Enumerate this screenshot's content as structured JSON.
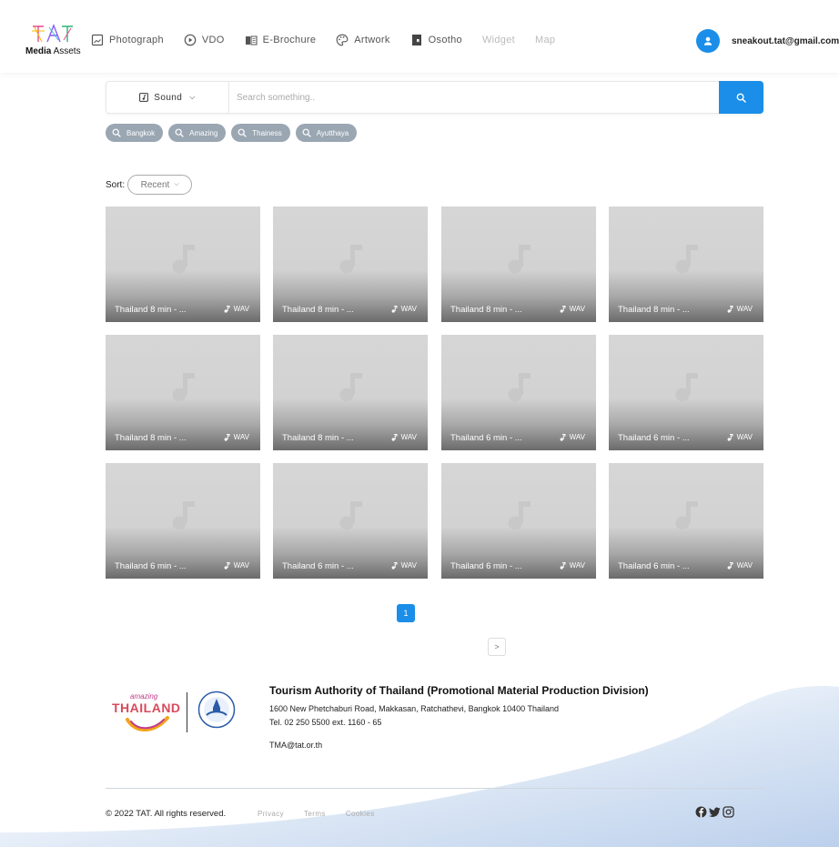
{
  "header": {
    "logo_text_bold": "Media",
    "logo_text": "Assets",
    "nav": [
      {
        "label": "Photograph",
        "icon": "photo-icon"
      },
      {
        "label": "VDO",
        "icon": "play-icon"
      },
      {
        "label": "E-Brochure",
        "icon": "book-icon"
      },
      {
        "label": "Artwork",
        "icon": "palette-icon"
      },
      {
        "label": "Osotho",
        "icon": "bookmark-icon"
      },
      {
        "label": "Widget",
        "icon": ""
      },
      {
        "label": "Map",
        "icon": ""
      }
    ],
    "user_email": "sneakout.tat@gmail.com"
  },
  "search": {
    "type_label": "Sound",
    "placeholder": "Search something..",
    "value": ""
  },
  "tags": [
    "Bangkok",
    "Amazing",
    "Thainess",
    "Ayutthaya"
  ],
  "sort": {
    "label": "Sort:",
    "value": "Recent"
  },
  "cards": [
    {
      "title": "Thailand 8 min - ...",
      "format": "WAV"
    },
    {
      "title": "Thailand 8 min - ...",
      "format": "WAV"
    },
    {
      "title": "Thailand 8 min - ...",
      "format": "WAV"
    },
    {
      "title": "Thailand 8 min - ...",
      "format": "WAV"
    },
    {
      "title": "Thailand 8 min - ...",
      "format": "WAV"
    },
    {
      "title": "Thailand 8 min - ...",
      "format": "WAV"
    },
    {
      "title": "Thailand 6 min - ...",
      "format": "WAV"
    },
    {
      "title": "Thailand 6 min - ...",
      "format": "WAV"
    },
    {
      "title": "Thailand 6 min - ...",
      "format": "WAV"
    },
    {
      "title": "Thailand 6 min - ...",
      "format": "WAV"
    },
    {
      "title": "Thailand 6 min - ...",
      "format": "WAV"
    },
    {
      "title": "Thailand 6 min - ...",
      "format": "WAV"
    }
  ],
  "pagination": {
    "prev": "<",
    "current": "1",
    "next": ">"
  },
  "footer": {
    "brand_small": "amazing",
    "brand_big": "THAILAND",
    "org_title": "Tourism Authority of Thailand (Promotional Material Production Division)",
    "address": "1600 New Phetchaburi Road, Makkasan, Ratchathevi, Bangkok 10400 Thailand",
    "tel": "Tel. 02 250 5500 ext. 1160 - 65",
    "email": "TMA@tat.or.th",
    "copyright": "© 2022 TAT. All rights reserved.",
    "links": [
      "Privacy",
      "Terms",
      "Cookies"
    ],
    "socials": [
      "facebook-icon",
      "twitter-icon",
      "instagram-icon"
    ]
  },
  "colors": {
    "accent": "#1a8ee8",
    "tag": "#9aa6b2"
  }
}
